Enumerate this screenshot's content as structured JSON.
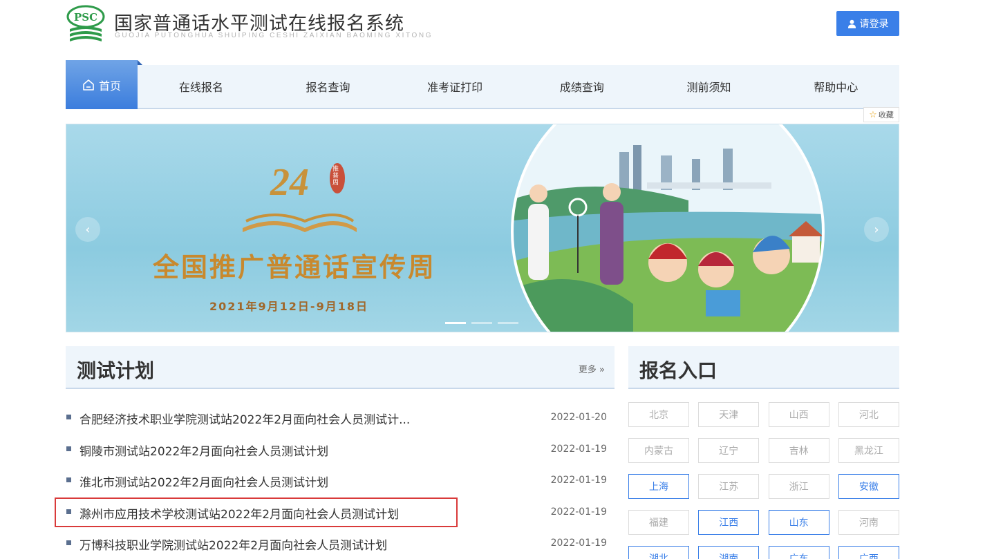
{
  "header": {
    "logo_text": "PSC",
    "title": "国家普通话水平测试在线报名系统",
    "subtitle": "GUOJIA PUTONGHUA SHUIPING CESHI ZAIXIAN BAOMING XITONG",
    "login_label": "请登录"
  },
  "nav": {
    "home_label": "首页",
    "items": [
      "在线报名",
      "报名查询",
      "准考证打印",
      "成绩查询",
      "测前须知",
      "帮助中心"
    ]
  },
  "favorite_label": "收藏",
  "banner": {
    "number": "24",
    "badge_text": "推普周",
    "title": "全国推广普通话宣传周",
    "date": "2021年9月12日-9月18日",
    "slide_count": 3,
    "active_slide": 1
  },
  "plans": {
    "title": "测试计划",
    "more_label": "更多 »",
    "items": [
      {
        "text": "合肥经济技术职业学院测试站2022年2月面向社会人员测试计...",
        "date": "2022-01-20"
      },
      {
        "text": "铜陵市测试站2022年2月面向社会人员测试计划",
        "date": "2022-01-19"
      },
      {
        "text": "淮北市测试站2022年2月面向社会人员测试计划",
        "date": "2022-01-19"
      },
      {
        "text": "滁州市应用技术学校测试站2022年2月面向社会人员测试计划",
        "date": "2022-01-19"
      },
      {
        "text": "万博科技职业学院测试站2022年2月面向社会人员测试计划",
        "date": "2022-01-19"
      }
    ]
  },
  "registration": {
    "title": "报名入口",
    "provinces": [
      {
        "name": "北京",
        "active": false
      },
      {
        "name": "天津",
        "active": false
      },
      {
        "name": "山西",
        "active": false
      },
      {
        "name": "河北",
        "active": false
      },
      {
        "name": "内蒙古",
        "active": false
      },
      {
        "name": "辽宁",
        "active": false
      },
      {
        "name": "吉林",
        "active": false
      },
      {
        "name": "黑龙江",
        "active": false
      },
      {
        "name": "上海",
        "active": true
      },
      {
        "name": "江苏",
        "active": false
      },
      {
        "name": "浙江",
        "active": false
      },
      {
        "name": "安徽",
        "active": true
      },
      {
        "name": "福建",
        "active": false
      },
      {
        "name": "江西",
        "active": true
      },
      {
        "name": "山东",
        "active": true
      },
      {
        "name": "河南",
        "active": false
      },
      {
        "name": "湖北",
        "active": true
      },
      {
        "name": "湖南",
        "active": true
      },
      {
        "name": "广东",
        "active": true
      },
      {
        "name": "广西",
        "active": true
      }
    ]
  },
  "colors": {
    "accent": "#3a7fe8",
    "nav_bg": "#eef5fb",
    "highlight": "#d93a3a"
  }
}
